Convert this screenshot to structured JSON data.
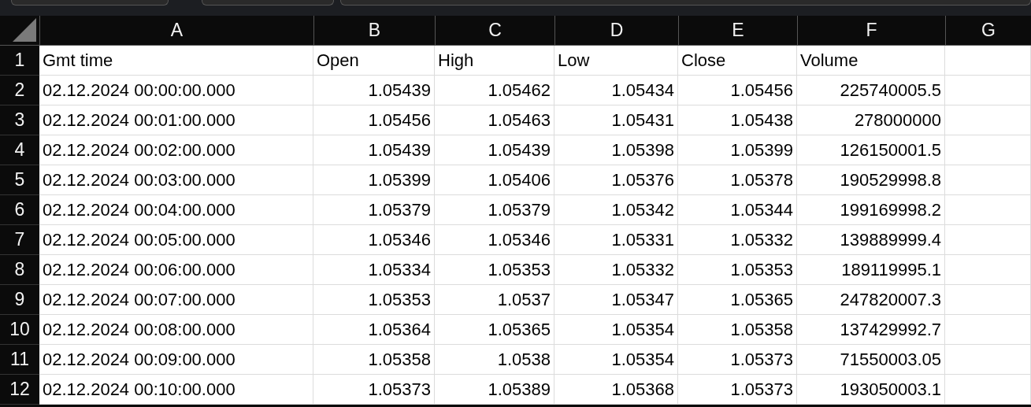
{
  "columns": [
    "A",
    "B",
    "C",
    "D",
    "E",
    "F",
    "G"
  ],
  "rows": [
    {
      "number": "1",
      "cells": [
        "Gmt time",
        "Open",
        "High",
        "Low",
        "Close",
        "Volume"
      ]
    },
    {
      "number": "2",
      "cells": [
        "02.12.2024 00:00:00.000",
        "1.05439",
        "1.05462",
        "1.05434",
        "1.05456",
        "225740005.5"
      ]
    },
    {
      "number": "3",
      "cells": [
        "02.12.2024 00:01:00.000",
        "1.05456",
        "1.05463",
        "1.05431",
        "1.05438",
        "278000000"
      ]
    },
    {
      "number": "4",
      "cells": [
        "02.12.2024 00:02:00.000",
        "1.05439",
        "1.05439",
        "1.05398",
        "1.05399",
        "126150001.5"
      ]
    },
    {
      "number": "5",
      "cells": [
        "02.12.2024 00:03:00.000",
        "1.05399",
        "1.05406",
        "1.05376",
        "1.05378",
        "190529998.8"
      ]
    },
    {
      "number": "6",
      "cells": [
        "02.12.2024 00:04:00.000",
        "1.05379",
        "1.05379",
        "1.05342",
        "1.05344",
        "199169998.2"
      ]
    },
    {
      "number": "7",
      "cells": [
        "02.12.2024 00:05:00.000",
        "1.05346",
        "1.05346",
        "1.05331",
        "1.05332",
        "139889999.4"
      ]
    },
    {
      "number": "8",
      "cells": [
        "02.12.2024 00:06:00.000",
        "1.05334",
        "1.05353",
        "1.05332",
        "1.05353",
        "189119995.1"
      ]
    },
    {
      "number": "9",
      "cells": [
        "02.12.2024 00:07:00.000",
        "1.05353",
        "1.0537",
        "1.05347",
        "1.05365",
        "247820007.3"
      ]
    },
    {
      "number": "10",
      "cells": [
        "02.12.2024 00:08:00.000",
        "1.05364",
        "1.05365",
        "1.05354",
        "1.05358",
        "137429992.7"
      ]
    },
    {
      "number": "11",
      "cells": [
        "02.12.2024 00:09:00.000",
        "1.05358",
        "1.0538",
        "1.05354",
        "1.05373",
        "71550003.05"
      ]
    },
    {
      "number": "12",
      "cells": [
        "02.12.2024 00:10:00.000",
        "1.05373",
        "1.05389",
        "1.05368",
        "1.05373",
        "193050003.1"
      ]
    }
  ]
}
